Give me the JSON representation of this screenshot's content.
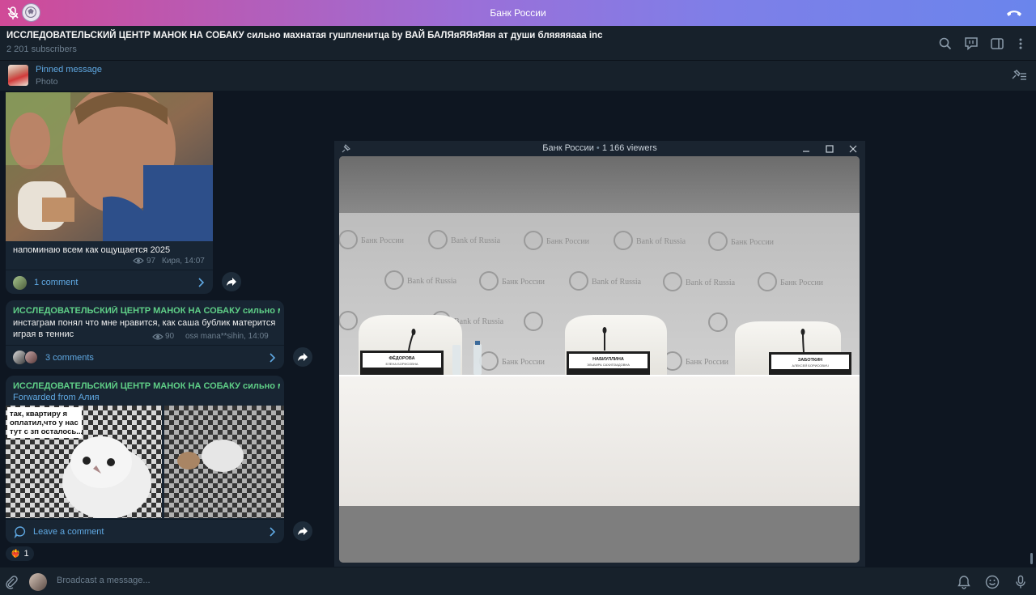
{
  "call_bar": {
    "title": "Банк России",
    "mute_icon": "mic-off-icon",
    "hangup_icon": "phone-hangup-icon",
    "gradient": [
      "#d04a97",
      "#6a85ec"
    ]
  },
  "header": {
    "channel_title": "ИССЛЕДОВАТЕЛЬСКИЙ ЦЕНТР МАНОК НА СОБАКУ сильно махнатая гушпленитца by ВАЙ БАЛЯяЯЯяЯяя ат души бляяяяааа inc",
    "subscribers": "2 201 subscribers",
    "icons": [
      "search-icon",
      "comments-icon",
      "sidebar-icon",
      "more-icon"
    ]
  },
  "pinned": {
    "title": "Pinned message",
    "subtitle": "Photo"
  },
  "messages": [
    {
      "text": "напоминаю всем как ощущается 2025",
      "views": "97",
      "author_time": "Киря, 14:07",
      "comments": "1 comment"
    },
    {
      "channel": "ИССЛЕДОВАТЕЛЬСКИЙ ЦЕНТР МАНОК НА СОБАКУ сильно ма...",
      "text_line1": "инстаграм понял что мне нравится, как саша бублик матерится",
      "text_line2": "играя в теннис",
      "views": "90",
      "author_time": "оsя mana**sihin, 14:09",
      "comments": "3 comments"
    },
    {
      "channel": "ИССЛЕДОВАТЕЛЬСКИЙ ЦЕНТР МАНОК НА СОБАКУ сильно ма...",
      "forwarded": "Forwarded from Алия",
      "meme_caption_1": "так, квартиру я",
      "meme_caption_2": "оплатил,что у нас",
      "meme_caption_3": "тут с зп осталось...",
      "comments": "Leave a comment",
      "reaction_emoji": "❤️‍🔥",
      "reaction_count": "1"
    }
  ],
  "video_window": {
    "title": "Банк России",
    "viewers": "1 166 viewers",
    "separator": "•",
    "backdrop_logo_ru": "Банк России",
    "backdrop_logo_en": "Bank of Russia",
    "nameplates": [
      {
        "surname": "ФЁДОРОВА",
        "name": "ЕЛЕНА БОРИСОВНА"
      },
      {
        "surname": "НАБИУЛЛИНА",
        "name": "ЭЛЬВИРА САХИПЗАДОВНА"
      },
      {
        "surname": "ЗАБОТКИН",
        "name": "АЛЕКСЕЙ БОРИСОВИЧ"
      }
    ]
  },
  "composer": {
    "placeholder": "Broadcast a message...",
    "icons": [
      "attach-icon",
      "bell-icon",
      "emoji-icon",
      "microphone-icon"
    ]
  }
}
